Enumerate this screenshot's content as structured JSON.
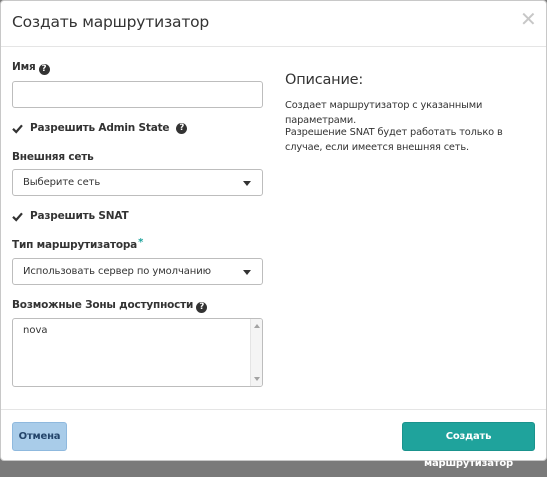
{
  "modal": {
    "title": "Создать маршрутизатор",
    "close_glyph": "✕"
  },
  "form": {
    "name": {
      "label": "Имя",
      "value": "",
      "help_icon": "question-circle-icon"
    },
    "admin_state": {
      "label": "Разрешить Admin State",
      "checked": true,
      "help_icon": "question-circle-icon"
    },
    "external_network": {
      "label": "Внешняя сеть",
      "selected": "Выберите сеть"
    },
    "enable_snat": {
      "label": "Разрешить SNAT",
      "checked": true
    },
    "router_type": {
      "label": "Тип маршрутизатора",
      "required_mark": "*",
      "selected": "Использовать сервер по умолчанию"
    },
    "availability_zones": {
      "label": "Возможные Зоны доступности",
      "items": [
        "nova"
      ],
      "help_icon": "question-circle-icon"
    }
  },
  "description": {
    "title": "Описание:",
    "paragraph1": "Создает маршрутизатор с указанными параметрами.",
    "paragraph2": "Разрешение SNAT будет работать только в случае, если имеется внешняя сеть."
  },
  "footer": {
    "cancel_label": "Отмена",
    "submit_label": "Создать маршрутизатор"
  },
  "colors": {
    "accent": "#1fa39c",
    "cancel_bg": "#a9cce9",
    "text": "#333333"
  }
}
